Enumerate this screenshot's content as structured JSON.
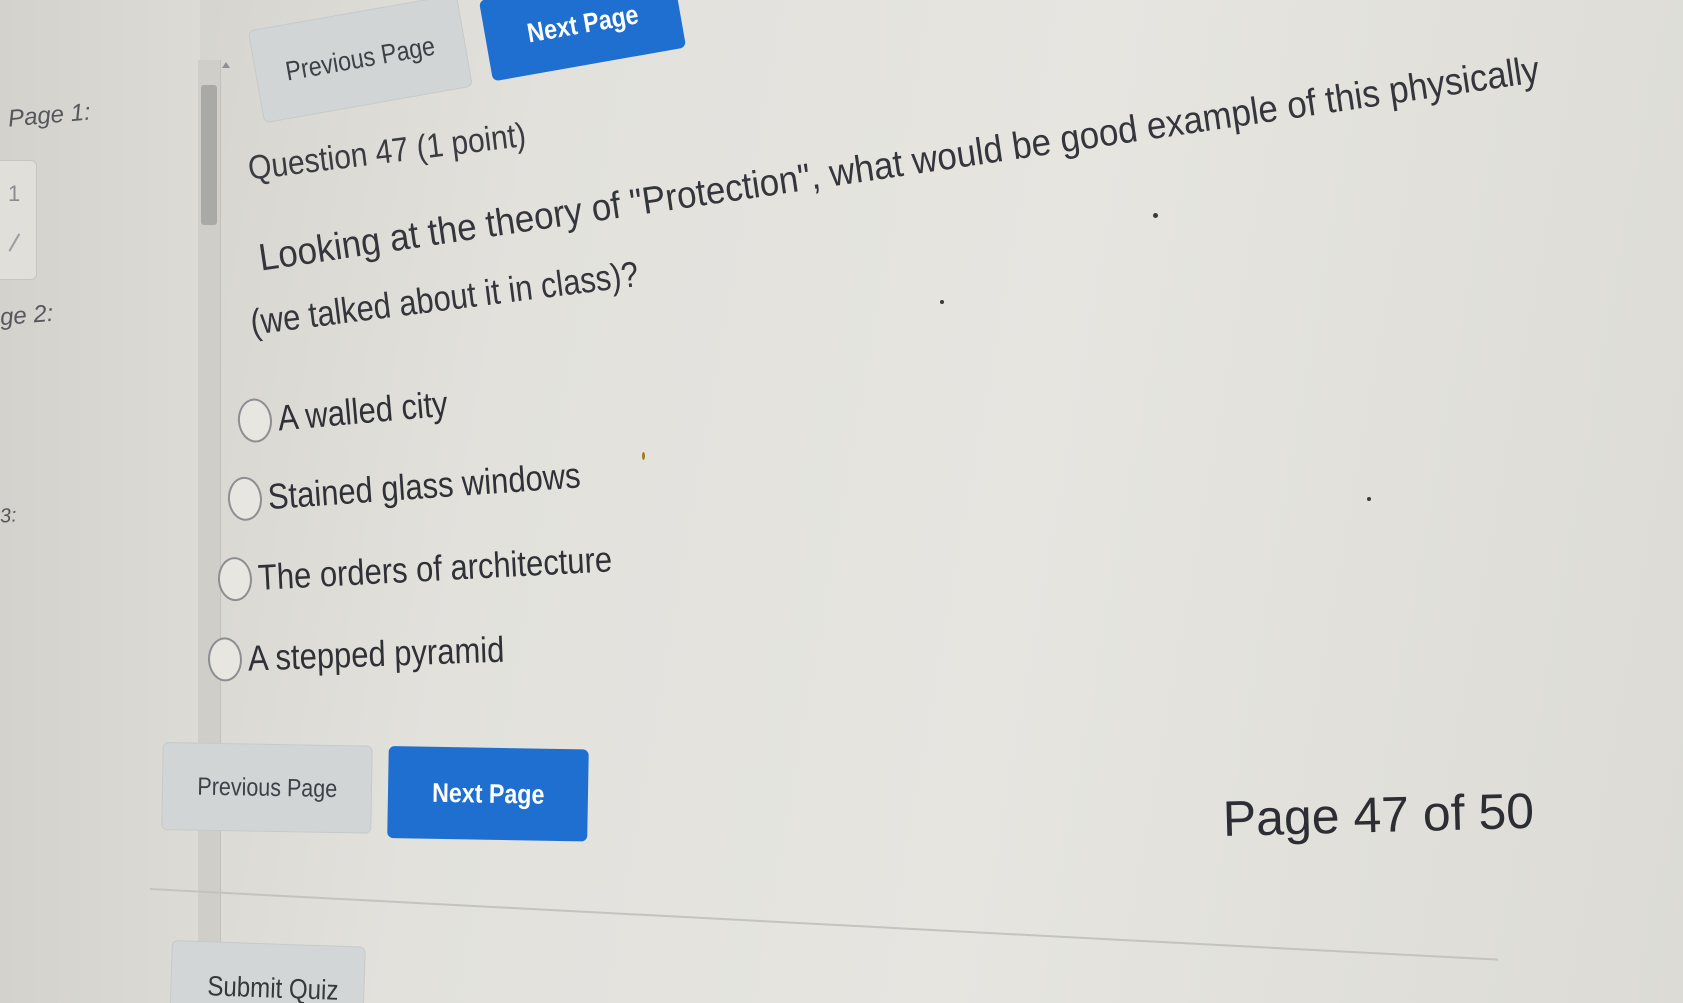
{
  "nav": {
    "page1_label": "Page 1:",
    "page1_index": "1",
    "page2_label": "ge 2:",
    "page3_label": "3:"
  },
  "top_buttons": {
    "previous_label": "Previous Page",
    "next_label": "Next Page"
  },
  "question": {
    "title": "Question 47 (1 point)",
    "text_line1": "Looking at the theory of \"Protection\", what would be good example of this physically",
    "text_line2": "(we talked about it in class)?",
    "options": [
      {
        "label": "A walled city"
      },
      {
        "label": "Stained glass windows"
      },
      {
        "label": "The orders of architecture"
      },
      {
        "label": "A stepped pyramid"
      }
    ]
  },
  "bottom_buttons": {
    "previous_label": "Previous Page",
    "next_label": "Next Page"
  },
  "pagination": {
    "text": "Page 47 of 50"
  },
  "submit": {
    "label": "Submit Quiz"
  },
  "colors": {
    "primary": "#1f6fd0",
    "secondary": "#d1d5d6",
    "text": "#34363c"
  }
}
